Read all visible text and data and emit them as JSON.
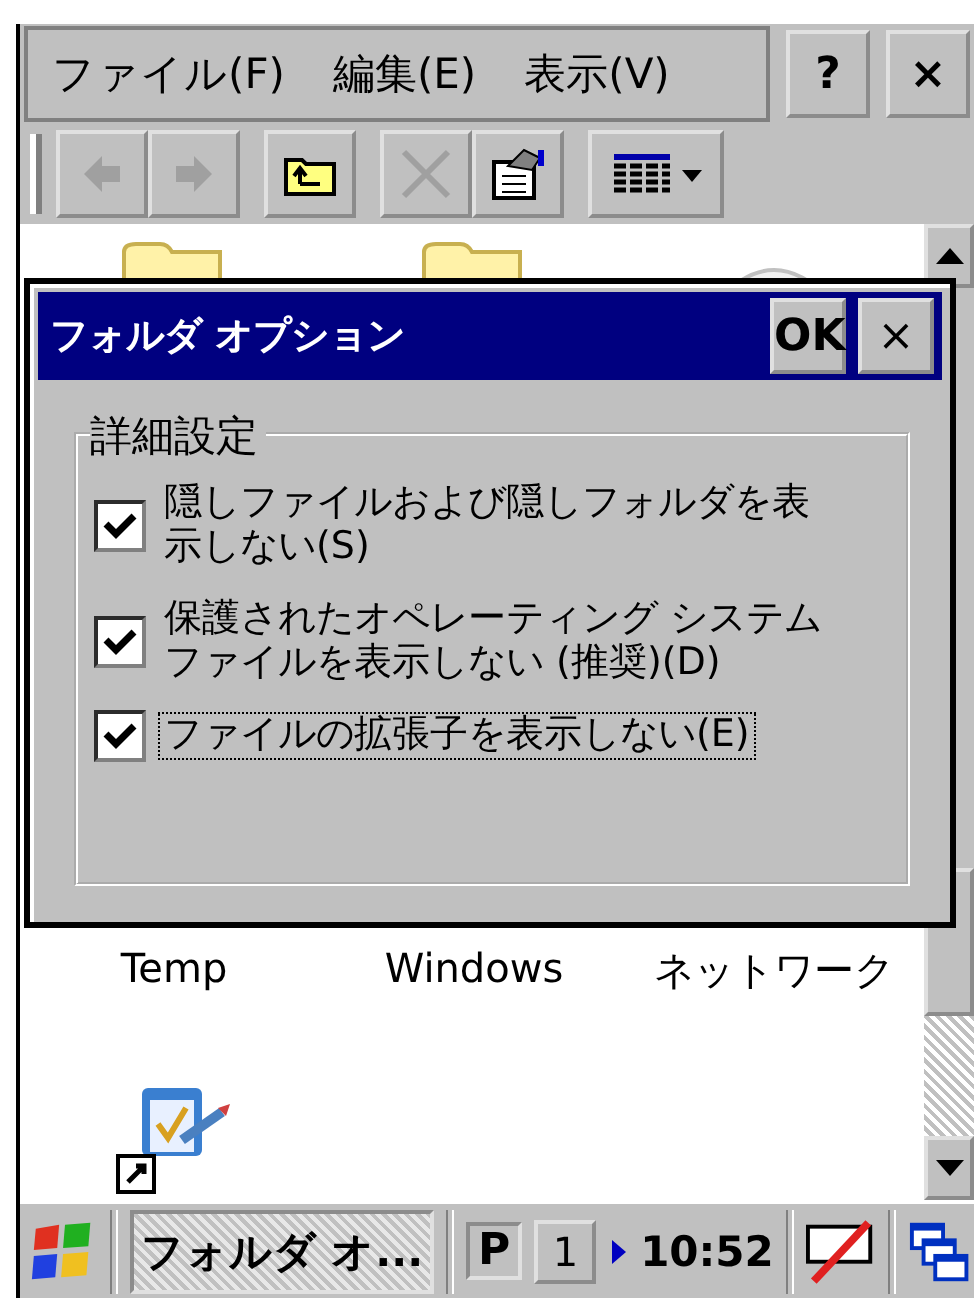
{
  "menu_bar": {
    "items": [
      {
        "label": "ファイル(F)"
      },
      {
        "label": "編集(E)"
      },
      {
        "label": "表示(V)"
      }
    ],
    "help_button": "?",
    "close_button": "×"
  },
  "toolbar": {
    "buttons": [
      {
        "kind": "back",
        "disabled": true
      },
      {
        "kind": "forward",
        "disabled": true
      },
      {
        "kind": "up-folder",
        "disabled": false
      },
      {
        "kind": "delete",
        "disabled": true
      },
      {
        "kind": "properties",
        "disabled": false
      },
      {
        "kind": "view-menu",
        "disabled": false
      }
    ]
  },
  "file_list": {
    "rows": [
      [
        {
          "kind": "folder"
        },
        {
          "kind": "folder"
        },
        {
          "kind": "device"
        }
      ],
      [
        {
          "label": "Temp"
        },
        {
          "label": "Windows"
        },
        {
          "label": "ネットワーク"
        }
      ],
      [
        {
          "kind": "shortcut"
        }
      ]
    ]
  },
  "dialog": {
    "title": "フォルダ オプション",
    "ok_button": "OK",
    "close_button": "×",
    "group_title": "詳細設定",
    "options": [
      {
        "lines": [
          "隠しファイルおよび隠しフォルダを表",
          "示しない(S)"
        ],
        "checked": true,
        "focused": false
      },
      {
        "lines": [
          "保護されたオペレーティング システム",
          "ファイルを表示しない (推奨)(D)"
        ],
        "checked": true,
        "focused": false
      },
      {
        "lines": [
          "ファイルの拡張子を表示しない(E)"
        ],
        "checked": true,
        "focused": true
      }
    ]
  },
  "taskbar": {
    "task_button": {
      "label": "フォルダ オ...",
      "selected": true
    },
    "input_indicator": "P",
    "page_button": "1",
    "time": "10:52"
  }
}
